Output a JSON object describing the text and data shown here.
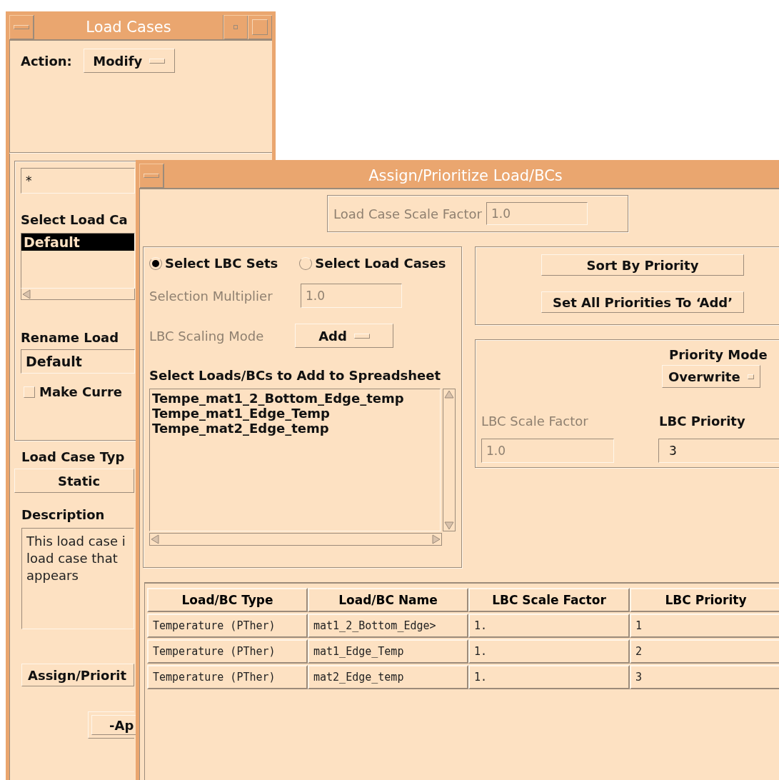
{
  "load_cases_window": {
    "title": "Load Cases",
    "action": {
      "label": "Action:",
      "value": "Modify"
    },
    "filter": {
      "value": "*"
    },
    "select_label": "Select Load Ca",
    "load_case_list": [
      {
        "label": "Default",
        "selected": true
      }
    ],
    "rename_label": "Rename Load",
    "rename": {
      "value": "Default"
    },
    "make_current": {
      "label": "Make Curre",
      "checked": false
    },
    "type_label": "Load Case Typ",
    "type_value": "Static",
    "description_label": "Description",
    "description": [
      "This load case i",
      "load case that",
      "appears"
    ],
    "assign_button": "Assign/Priorit",
    "apply_button": "-Ap"
  },
  "assign_window": {
    "title": "Assign/Prioritize Load/BCs",
    "scale_factor": {
      "label": "Load Case Scale Factor",
      "value": "1.0",
      "disabled": true
    },
    "selection_mode": [
      {
        "label": "Select LBC Sets",
        "selected": true
      },
      {
        "label": "Select Load Cases",
        "selected": false
      }
    ],
    "selection_multiplier": {
      "label": "Selection Multiplier",
      "value": "1.0",
      "disabled": true
    },
    "scaling_mode": {
      "label": "LBC Scaling Mode",
      "value": "Add",
      "disabled": true
    },
    "loads_label": "Select Loads/BCs to Add to Spreadsheet",
    "loads": [
      "Tempe_mat1_2_Bottom_Edge_temp",
      "Tempe_mat1_Edge_Temp",
      "Tempe_mat2_Edge_temp"
    ],
    "actions": [
      "Sort By Priority",
      "Set All Priorities To ‘Add’"
    ],
    "priority_mode": {
      "label": "Priority Mode",
      "value": "Overwrite"
    },
    "lbc_scale_factor": {
      "label": "LBC Scale Factor",
      "value": "1.0",
      "disabled": true
    },
    "lbc_priority": {
      "label": "LBC Priority",
      "value": "3",
      "disabled": false
    },
    "table": {
      "columns": [
        "Load/BC Type",
        "Load/BC Name",
        "LBC Scale Factor",
        "LBC Priority"
      ],
      "rows": [
        [
          "Temperature (PTher)",
          "mat1_2_Bottom_Edge>",
          "1.",
          "1"
        ],
        [
          "Temperature (PTher)",
          "mat1_Edge_Temp",
          "1.",
          "2"
        ],
        [
          "Temperature (PTher)",
          "mat2_Edge_temp",
          "1.",
          "3"
        ]
      ]
    }
  }
}
